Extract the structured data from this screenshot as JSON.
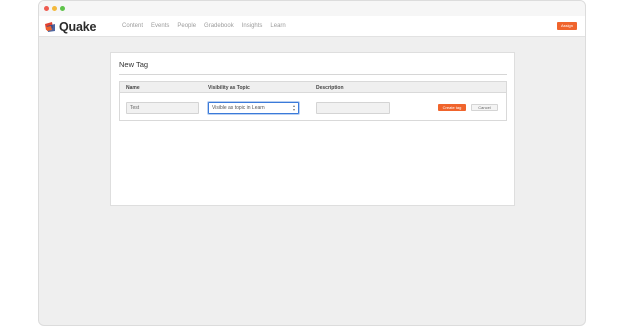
{
  "app": {
    "name": "Quake",
    "brand_color": "#f0642c",
    "logo_icon": "quake-logo-icon"
  },
  "nav": {
    "items": [
      "Content",
      "Events",
      "People",
      "Gradebook",
      "Insights",
      "Learn"
    ]
  },
  "header": {
    "assign_label": "Assign"
  },
  "form": {
    "title": "New Tag",
    "columns": {
      "name": "Name",
      "visibility": "Visibility as Topic",
      "description": "Description"
    },
    "name_value": "Test",
    "visibility_value": "Visible as topic in Learn",
    "description_value": "",
    "create_label": "Create tag",
    "cancel_label": "Cancel"
  }
}
